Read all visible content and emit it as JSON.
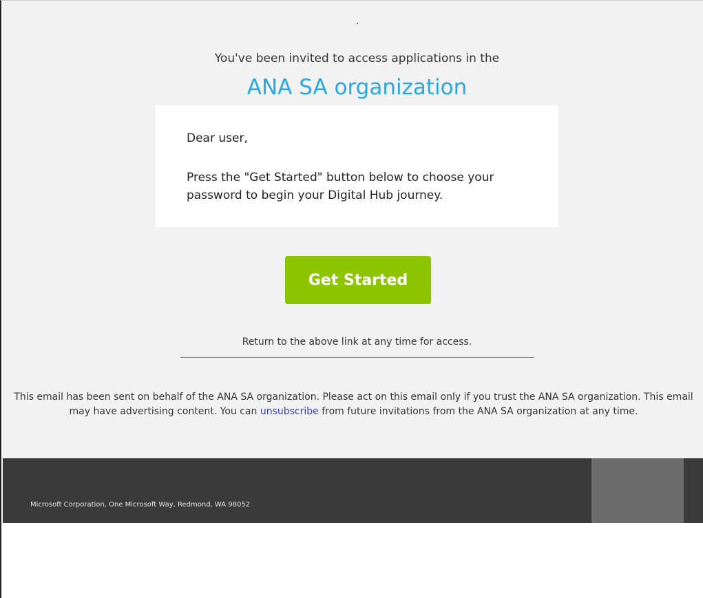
{
  "header": {
    "dot": ".",
    "invite_text": "You've been invited to access applications in the",
    "organization": "ANA SA organization"
  },
  "card": {
    "greeting": "Dear user,",
    "message": "Press the \"Get Started\" button below to choose your password to begin your Digital Hub journey."
  },
  "cta": {
    "label": "Get Started"
  },
  "return_text": "Return to the above link at any time for access.",
  "disclaimer": {
    "before_link": "This email has been sent on behalf of the ANA SA organization. Please act on this email only if you trust the ANA SA organization. This email may have advertising content. You can ",
    "link_text": "unsubscribe",
    "after_link": " from future invitations from the ANA SA organization at any time."
  },
  "footer": {
    "address": "Microsoft Corporation, One Microsoft Way, Redmond, WA 98052"
  },
  "colors": {
    "accent_blue": "#2ba7e0",
    "button_green": "#8dc600",
    "link_blue": "#2b3fd6",
    "footer_bg": "#3a3a3a"
  }
}
